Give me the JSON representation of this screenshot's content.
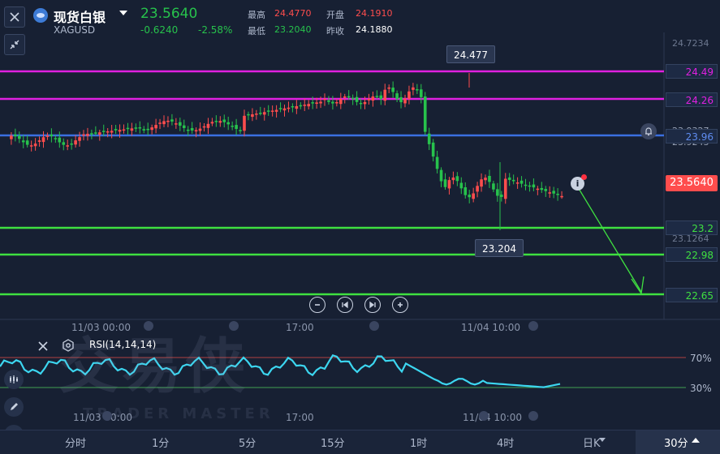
{
  "symbol": {
    "name": "现货白银",
    "code": "XAGUSD",
    "price": "23.5640",
    "change": "-0.6240",
    "change_pct": "-2.58%"
  },
  "stats": {
    "high_label": "最高",
    "high": "24.4770",
    "open_label": "开盘",
    "open": "24.1910",
    "low_label": "最低",
    "low": "23.2040",
    "prev_label": "昨收",
    "prev": "24.1880"
  },
  "price_axis": {
    "top": "24.7234",
    "partial1": "23.9327",
    "partial2": "23.9243",
    "bottom": "23.1264"
  },
  "levels": {
    "l1": "24.49",
    "l2": "24.26",
    "l3": "23.96",
    "l4": "23.2",
    "l5": "22.98",
    "l6": "22.65"
  },
  "current_price_tag": "23.5640",
  "tooltips": {
    "high": "24.477",
    "low": "23.204"
  },
  "time_labels": {
    "t1": "11/03 00:00",
    "t2": "17:00",
    "t3": "11/04 10:00"
  },
  "rsi": {
    "title": "RSI(14,14,14)",
    "level_70": "70%",
    "level_30": "30%"
  },
  "watermark": {
    "cn": "交易侠",
    "en": "TRADER MASTER"
  },
  "tabs": [
    "分时",
    "1分",
    "5分",
    "15分",
    "1时",
    "4时",
    "日K",
    "30分"
  ],
  "colors": {
    "up": "#ff4d4d",
    "down": "#27c24c",
    "resistance": "#e020e0",
    "pivot": "#3a6fe0",
    "support": "#3fe040",
    "rsi": "#3cd6f0"
  },
  "chart_data": {
    "type": "candlestick",
    "title": "",
    "ohlc_summary": {
      "open": 24.191,
      "high": 24.477,
      "low": 23.204,
      "last": 23.564,
      "prev_close": 24.188
    },
    "horizontal_levels": [
      24.49,
      24.26,
      23.96,
      23.2,
      22.98,
      22.65
    ],
    "projection": {
      "from": 23.564,
      "to": 22.65
    },
    "rsi_params": [
      14,
      14,
      14
    ],
    "rsi_levels": [
      70,
      30
    ]
  }
}
